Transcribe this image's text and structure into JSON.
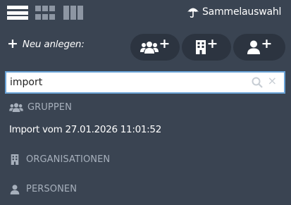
{
  "toolbar": {
    "view_list_icon": "list-view-icon",
    "view_grid_icon": "grid-view-icon",
    "view_columns_icon": "columns-view-icon",
    "sammel_icon": "umbrella-icon",
    "sammel_label": "Sammelauswahl"
  },
  "create": {
    "plus": "+",
    "label": "Neu anlegen:",
    "buttons": [
      {
        "icon": "group-add-icon",
        "plus": "+"
      },
      {
        "icon": "organisation-add-icon",
        "plus": "+"
      },
      {
        "icon": "person-add-icon",
        "plus": "+"
      }
    ]
  },
  "search": {
    "value": "import",
    "search_icon": "search-icon",
    "clear_label": "×"
  },
  "sections": {
    "groups": {
      "icon": "group-icon",
      "title": "GRUPPEN",
      "results": [
        "Import vom 27.01.2026 11:01:52"
      ]
    },
    "organisations": {
      "icon": "building-icon",
      "title": "ORGANISATIONEN"
    },
    "persons": {
      "icon": "person-icon",
      "title": "PERSONEN"
    }
  },
  "colors": {
    "background": "#3a4452",
    "pill": "#2c3440",
    "search_border": "#6aa4d8",
    "section_text": "#a7b0bc",
    "inactive_icon": "#8d96a3"
  }
}
